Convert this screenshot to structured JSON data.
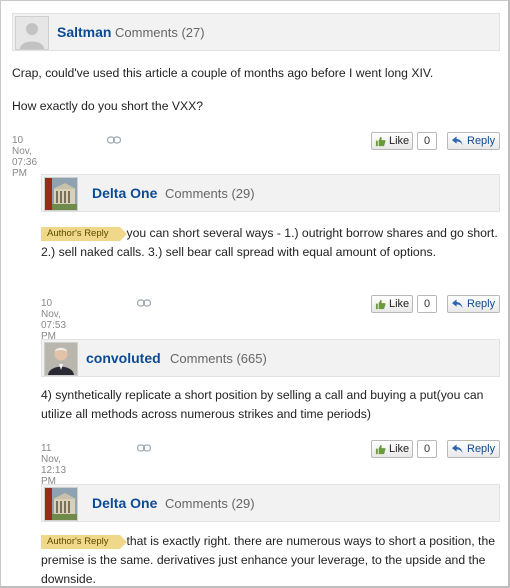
{
  "comments": [
    {
      "author": "Saltman",
      "count": "Comments (27)",
      "paragraphs": [
        "Crap, could've used this article a couple of months ago before I went long XIV.",
        "How exactly do you short the VXX?"
      ],
      "timestamp": "10 Nov, 07:36 PM",
      "like_label": "Like",
      "like_count": "0",
      "reply_label": "Reply"
    },
    {
      "author": "Delta One",
      "count": "Comments (29)",
      "tag": "Author's Reply",
      "text": "you can short several ways - 1.) outright borrow shares and go short. 2.) sell naked calls. 3.) sell bear call spread with equal amount of options.",
      "timestamp": "10 Nov, 07:53 PM",
      "like_label": "Like",
      "like_count": "0",
      "reply_label": "Reply"
    },
    {
      "author": "convoluted",
      "count": "Comments (665)",
      "text": "4) synthetically replicate a short position by selling a call and buying a put(you can utilize all methods across numerous strikes and time periods)",
      "timestamp": "11 Nov, 12:13 PM",
      "like_label": "Like",
      "like_count": "0",
      "reply_label": "Reply"
    },
    {
      "author": "Delta One",
      "count": "Comments (29)",
      "tag": "Author's Reply",
      "text": "that is exactly right. there are numerous ways to short a position, the premise is the same. derivatives just enhance your leverage, to the upside and the downside."
    }
  ],
  "colors": {
    "link": "#0d4a94",
    "tag": "#f0d88a",
    "header_bg": "#f2f2f2"
  },
  "icons": {
    "avatar_default": "user-silhouette-icon",
    "avatar_building": "building-photo-icon",
    "avatar_person": "person-photo-icon",
    "permalink": "chain-link-icon",
    "like": "thumbs-up-icon",
    "reply": "reply-arrow-icon"
  }
}
